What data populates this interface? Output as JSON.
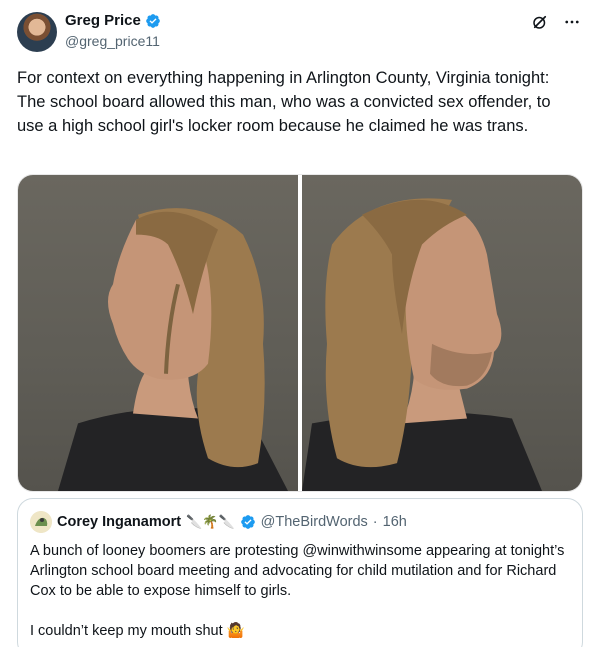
{
  "tweet": {
    "author_name": "Greg Price",
    "author_handle": "@greg_price11",
    "text": "For context on everything happening in Arlington County, Virginia tonight: The school board allowed this man, who was a convicted sex offender, to use a high school girl's locker room because he claimed he was trans."
  },
  "icons": {
    "verified": "verified-badge-icon",
    "grok": "grok-icon",
    "more": "more-icon"
  },
  "quote": {
    "author_name": "Corey Inganamort",
    "name_emojis": "🔪🌴🔪",
    "author_handle": "@TheBirdWords",
    "dot": "·",
    "time": "16h",
    "paragraphs": [
      "A bunch of looney boomers are protesting @winwithwinsome appearing at tonight’s Arlington school board meeting and advocating for child mutilation and for Richard Cox to be able to expose himself to girls.",
      "I couldn’t keep my mouth shut 🤷"
    ]
  },
  "colors": {
    "text": "#0f1419",
    "secondary": "#536471",
    "verified": "#1d9bf0",
    "border": "#cfd9de"
  }
}
